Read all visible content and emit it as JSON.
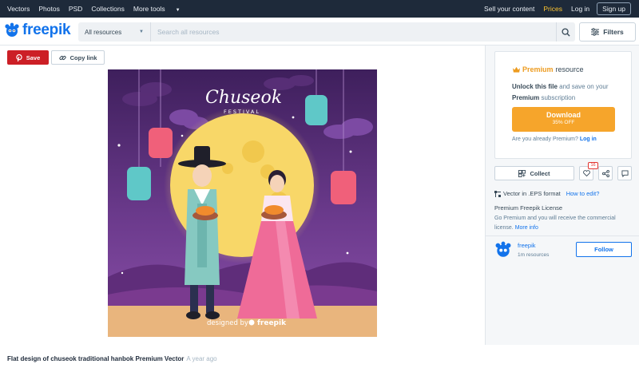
{
  "topbar": {
    "nav": [
      "Vectors",
      "Photos",
      "PSD",
      "Collections"
    ],
    "more_tools": "More tools",
    "sell": "Sell your content",
    "prices": "Prices",
    "login": "Log in",
    "signup": "Sign up"
  },
  "header": {
    "logo_text": "freepik",
    "resource_select": "All resources",
    "search_placeholder": "Search all resources",
    "filters_label": "Filters"
  },
  "actions": {
    "save_label": "Save",
    "copy_link_label": "Copy link"
  },
  "artwork": {
    "title_script": "Chuseok",
    "title_sub": "FESTIVAL",
    "watermark_text": "designed by",
    "watermark_brand": "freepik"
  },
  "caption": {
    "title": "Flat design of chuseok traditional hanbok Premium Vector",
    "age": "A year ago"
  },
  "premium": {
    "premium_word": "Premium",
    "resource_word": "resource",
    "unlock_bold": "Unlock this file",
    "unlock_rest": "and save on your",
    "premium_sub_bold": "Premium",
    "premium_sub_rest": "subscription",
    "download_label": "Download",
    "discount_label": "35% OFF",
    "already_text": "Are you already Premium?",
    "login_link": "Log in"
  },
  "collect": {
    "collect_label": "Collect",
    "likes_count": "16"
  },
  "format": {
    "format_text": "Vector in .EPS format",
    "how_to_edit": "How to edit?"
  },
  "license": {
    "title": "Premium Freepik License",
    "text": "Go Premium and you will receive the commercial license.",
    "more_info": "More info"
  },
  "author": {
    "name": "freepik",
    "resources": "1m resources",
    "follow_label": "Follow"
  },
  "colors": {
    "topbar_bg": "#1e2a3a",
    "brand_blue": "#1273eb",
    "save_red": "#cc1f26",
    "download_orange": "#f6a52b",
    "prices_yellow": "#fec530"
  }
}
